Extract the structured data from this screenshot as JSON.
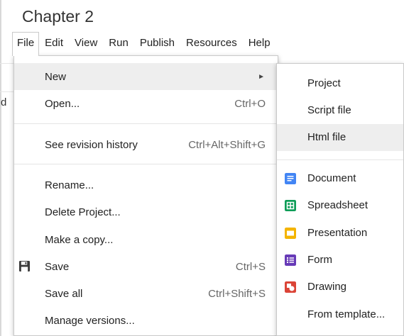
{
  "window": {
    "title": "Chapter 2"
  },
  "menubar": {
    "items": [
      "File",
      "Edit",
      "View",
      "Run",
      "Publish",
      "Resources",
      "Help"
    ]
  },
  "background": {
    "partial_text": "d"
  },
  "file_menu": {
    "new": {
      "label": "New"
    },
    "open": {
      "label": "Open...",
      "shortcut": "Ctrl+O"
    },
    "revision": {
      "label": "See revision history",
      "shortcut": "Ctrl+Alt+Shift+G"
    },
    "rename": {
      "label": "Rename..."
    },
    "delete": {
      "label": "Delete Project..."
    },
    "copy": {
      "label": "Make a copy..."
    },
    "save": {
      "label": "Save",
      "shortcut": "Ctrl+S"
    },
    "save_all": {
      "label": "Save all",
      "shortcut": "Ctrl+Shift+S"
    },
    "manage": {
      "label": "Manage versions..."
    }
  },
  "new_submenu": {
    "project": "Project",
    "script": "Script file",
    "html": "Html file",
    "document": "Document",
    "spreadsheet": "Spreadsheet",
    "presentation": "Presentation",
    "form": "Form",
    "drawing": "Drawing",
    "template": "From template..."
  },
  "icons": {
    "document": "document-icon",
    "spreadsheet": "spreadsheet-icon",
    "presentation": "presentation-icon",
    "form": "form-icon",
    "drawing": "drawing-icon",
    "save": "floppy-disk-icon",
    "submenu_arrow": "triangle-right-icon"
  },
  "colors": {
    "document": "#4285f4",
    "spreadsheet": "#0f9d58",
    "presentation": "#f4b400",
    "form": "#673ab7",
    "drawing": "#db4437",
    "highlight": "#eeeeee"
  }
}
